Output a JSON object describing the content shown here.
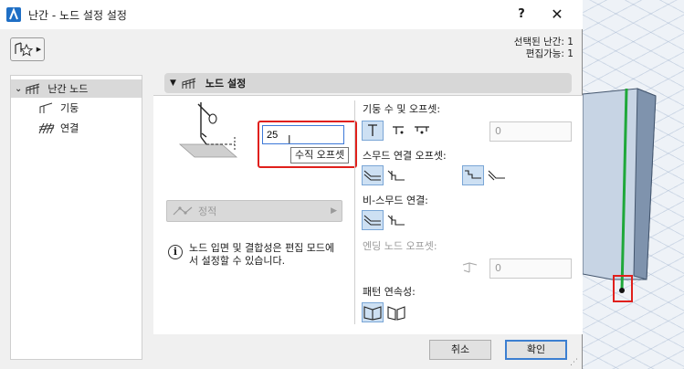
{
  "window": {
    "title": "난간 - 노드 설정 설정",
    "help_label": "?",
    "close_label": "✕"
  },
  "selection_info": {
    "selected": "선택된 난간: 1",
    "editable": "편집가능: 1"
  },
  "tree": {
    "items": [
      {
        "label": "난간 노드",
        "expanded": true,
        "selected": true
      },
      {
        "label": "기둥"
      },
      {
        "label": "연결"
      }
    ]
  },
  "panel": {
    "header": "노드 설정"
  },
  "vertical_offset": {
    "value": "25",
    "tooltip": "수직 오프셋"
  },
  "static_dropdown": {
    "label": "정적"
  },
  "info": {
    "text": "노드 입면 및 결합성은 편집 모드에서 설정할 수 있습니다."
  },
  "right_panel": {
    "post_offset_label": "기둥 수 및 오프셋:",
    "post_offset_value": "0",
    "spud_offset_label": "스무드 연결 오프셋:",
    "non_spud_label": "비-스무드 연결:",
    "end_node_label": "엔딩 노드 오프셋:",
    "end_node_value": "0",
    "pattern_label": "패턴 연속성:"
  },
  "buttons": {
    "cancel": "취소",
    "ok": "확인"
  },
  "colors": {
    "accent": "#3c7fd1",
    "highlight_red": "#e0201c",
    "rail_green": "#1fa83a",
    "selected_bg": "#cde0f3"
  }
}
